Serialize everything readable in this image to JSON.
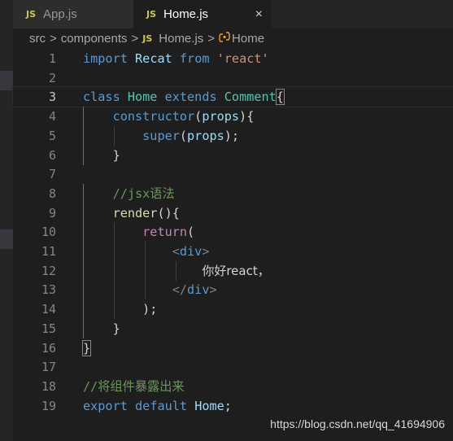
{
  "tabs": [
    {
      "icon": "JS",
      "label": "App.js"
    },
    {
      "icon": "JS",
      "label": "Home.js",
      "close": "×"
    }
  ],
  "breadcrumb": {
    "parts": [
      "src",
      "components"
    ],
    "file_icon": "JS",
    "file": "Home.js",
    "symbol_icon": "class-icon",
    "symbol": "Home",
    "separator": ">"
  },
  "code": {
    "current_line": 3,
    "lines": [
      {
        "n": "1",
        "t": [
          [
            "kw",
            "import"
          ],
          [
            "p",
            " "
          ],
          [
            "vr",
            "Recat"
          ],
          [
            "p",
            " "
          ],
          [
            "kw",
            "from"
          ],
          [
            "p",
            " "
          ],
          [
            "str",
            "'react'"
          ]
        ]
      },
      {
        "n": "2",
        "t": []
      },
      {
        "n": "3",
        "t": [
          [
            "kw",
            "class"
          ],
          [
            "p",
            " "
          ],
          [
            "cls",
            "Home"
          ],
          [
            "p",
            " "
          ],
          [
            "kw",
            "extends"
          ],
          [
            "p",
            " "
          ],
          [
            "cls",
            "Comment"
          ],
          [
            "bm",
            "{"
          ]
        ]
      },
      {
        "n": "4",
        "t": [
          [
            "p",
            "    "
          ],
          [
            "kw",
            "constructor"
          ],
          [
            "p",
            "("
          ],
          [
            "vr",
            "props"
          ],
          [
            "p",
            "){"
          ]
        ]
      },
      {
        "n": "5",
        "t": [
          [
            "p",
            "        "
          ],
          [
            "kw",
            "super"
          ],
          [
            "p",
            "("
          ],
          [
            "vr",
            "props"
          ],
          [
            "p",
            ");"
          ]
        ]
      },
      {
        "n": "6",
        "t": [
          [
            "p",
            "    }"
          ]
        ]
      },
      {
        "n": "7",
        "t": []
      },
      {
        "n": "8",
        "t": [
          [
            "p",
            "    "
          ],
          [
            "cmt",
            "//jsx语法"
          ]
        ]
      },
      {
        "n": "9",
        "t": [
          [
            "p",
            "    "
          ],
          [
            "fn",
            "render"
          ],
          [
            "p",
            "(){"
          ]
        ]
      },
      {
        "n": "10",
        "t": [
          [
            "p",
            "        "
          ],
          [
            "ctl",
            "return"
          ],
          [
            "p",
            "("
          ]
        ]
      },
      {
        "n": "11",
        "t": [
          [
            "p",
            "            "
          ],
          [
            "br",
            "<"
          ],
          [
            "tg",
            "div"
          ],
          [
            "br",
            ">"
          ]
        ]
      },
      {
        "n": "12",
        "t": [
          [
            "p",
            "                "
          ],
          [
            "txt",
            "你好react，"
          ]
        ]
      },
      {
        "n": "13",
        "t": [
          [
            "p",
            "            "
          ],
          [
            "br",
            "</"
          ],
          [
            "tg",
            "div"
          ],
          [
            "br",
            ">"
          ]
        ]
      },
      {
        "n": "14",
        "t": [
          [
            "p",
            "        );"
          ]
        ]
      },
      {
        "n": "15",
        "t": [
          [
            "p",
            "    }"
          ]
        ]
      },
      {
        "n": "16",
        "t": [
          [
            "bm",
            "}"
          ]
        ]
      },
      {
        "n": "17",
        "t": []
      },
      {
        "n": "18",
        "t": [
          [
            "cmt",
            "//将组件暴露出来"
          ]
        ]
      },
      {
        "n": "19",
        "t": [
          [
            "kw",
            "export"
          ],
          [
            "p",
            " "
          ],
          [
            "kw",
            "default"
          ],
          [
            "p",
            " "
          ],
          [
            "vr",
            "Home"
          ],
          [
            "p",
            ";"
          ]
        ]
      }
    ]
  },
  "watermark": "https://blog.csdn.net/qq_41694906",
  "colors": {
    "background": "#1e1e1e",
    "keyword": "#569cd6",
    "control": "#c586c0",
    "class": "#4ec9b0",
    "variable": "#9cdcfe",
    "function": "#dcdcaa",
    "string": "#ce9178",
    "comment": "#6a9955",
    "js_icon": "#cbcb41"
  }
}
